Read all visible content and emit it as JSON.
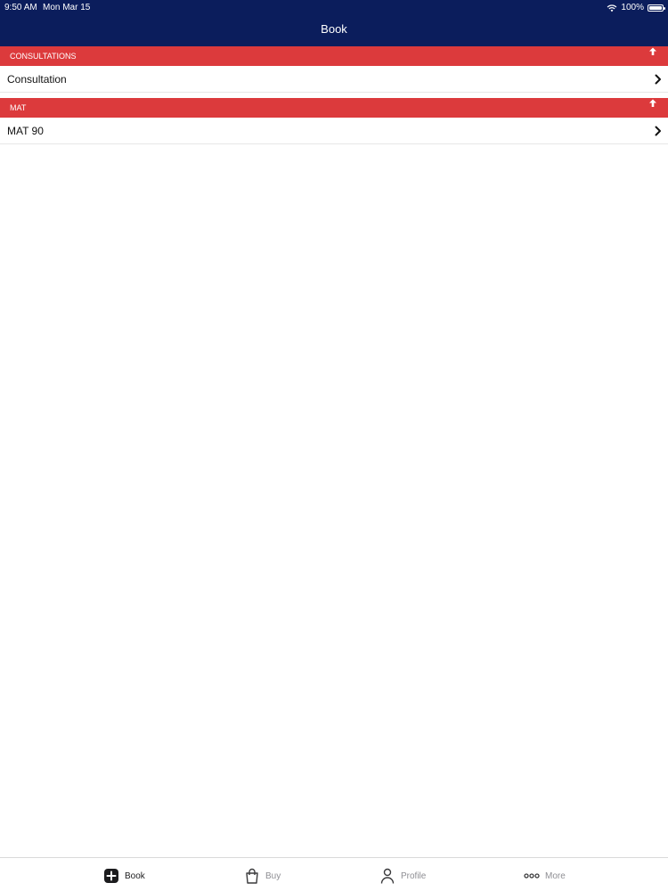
{
  "status_bar": {
    "time": "9:50 AM",
    "date": "Mon Mar 15",
    "battery": "100%"
  },
  "nav": {
    "title": "Book"
  },
  "sections": [
    {
      "header": "CONSULTATIONS",
      "items": [
        "Consultation"
      ]
    },
    {
      "header": "MAT",
      "items": [
        "MAT 90"
      ]
    }
  ],
  "tabbar": {
    "tabs": [
      {
        "label": "Book",
        "icon": "plus-square-icon",
        "active": true
      },
      {
        "label": "Buy",
        "icon": "shopping-bag-icon",
        "active": false
      },
      {
        "label": "Profile",
        "icon": "person-icon",
        "active": false
      },
      {
        "label": "More",
        "icon": "more-dots-icon",
        "active": false
      }
    ]
  },
  "colors": {
    "nav_background": "#0b1d5c",
    "section_header": "#dc3a3c",
    "tab_active": "#1c1c1e",
    "tab_inactive": "#8e8e93"
  }
}
